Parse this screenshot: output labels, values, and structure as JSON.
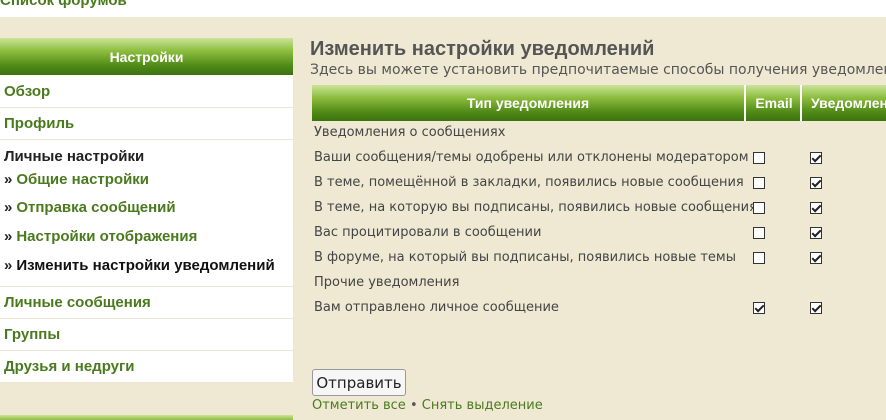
{
  "top": {
    "forum_list_link": "Список форумов"
  },
  "sidebar": {
    "heading": "Настройки",
    "items_top": [
      {
        "label": "Обзор"
      },
      {
        "label": "Профиль"
      }
    ],
    "group": {
      "title": "Личные настройки",
      "bullet": "»",
      "subitems": [
        {
          "label": "Общие настройки"
        },
        {
          "label": "Отправка сообщений"
        },
        {
          "label": "Настройки отображения"
        },
        {
          "label": "Изменить настройки уведомлений"
        }
      ]
    },
    "items_bottom": [
      {
        "label": "Личные сообщения"
      },
      {
        "label": "Группы"
      },
      {
        "label": "Друзья и недруги"
      }
    ]
  },
  "main": {
    "title": "Изменить настройки уведомлений",
    "description": "Здесь вы можете установить предпочитаемые способы получения уведомлений",
    "table": {
      "headers": {
        "type": "Тип уведомления",
        "email": "Email",
        "notifications": "Уведомления"
      },
      "rows": [
        {
          "kind": "section",
          "label": "Уведомления о сообщениях"
        },
        {
          "kind": "option",
          "label": "Ваши сообщения/темы одобрены или отклонены модератором",
          "email": false,
          "notify": true
        },
        {
          "kind": "option",
          "label": "В теме, помещённой в закладки, появились новые сообщения",
          "email": false,
          "notify": true
        },
        {
          "kind": "option",
          "label": "В теме, на которую вы подписаны, появились новые сообщения",
          "email": false,
          "notify": true
        },
        {
          "kind": "option",
          "label": "Вас процитировали в сообщении",
          "email": false,
          "notify": true
        },
        {
          "kind": "option",
          "label": "В форуме, на который вы подписаны, появились новые темы",
          "email": false,
          "notify": true
        },
        {
          "kind": "section",
          "label": "Прочие уведомления"
        },
        {
          "kind": "option",
          "label": "Вам отправлено личное сообщение",
          "email": true,
          "notify": true
        }
      ]
    },
    "submit_label": "Отправить",
    "mark_all": "Отметить все",
    "separator": "•",
    "unmark_all": "Снять выделение"
  }
}
